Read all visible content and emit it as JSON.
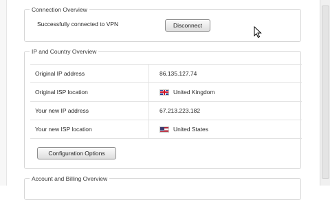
{
  "connection_overview": {
    "title": "Connection Overview",
    "status": "Successfully connected to VPN",
    "disconnect_label": "Disconnect"
  },
  "ip_overview": {
    "title": "IP and Country Overview",
    "rows": [
      {
        "label": "Original IP address",
        "value": "86.135.127.74",
        "flag": ""
      },
      {
        "label": "Original ISP location",
        "value": "United Kingdom",
        "flag": "uk-flag-icon"
      },
      {
        "label": "Your new IP address",
        "value": "67.213.223.182",
        "flag": ""
      },
      {
        "label": "Your new ISP location",
        "value": "United States",
        "flag": "us-flag-icon"
      }
    ],
    "config_label": "Configuration Options"
  },
  "account_overview": {
    "title": "Account and Billing Overview"
  }
}
